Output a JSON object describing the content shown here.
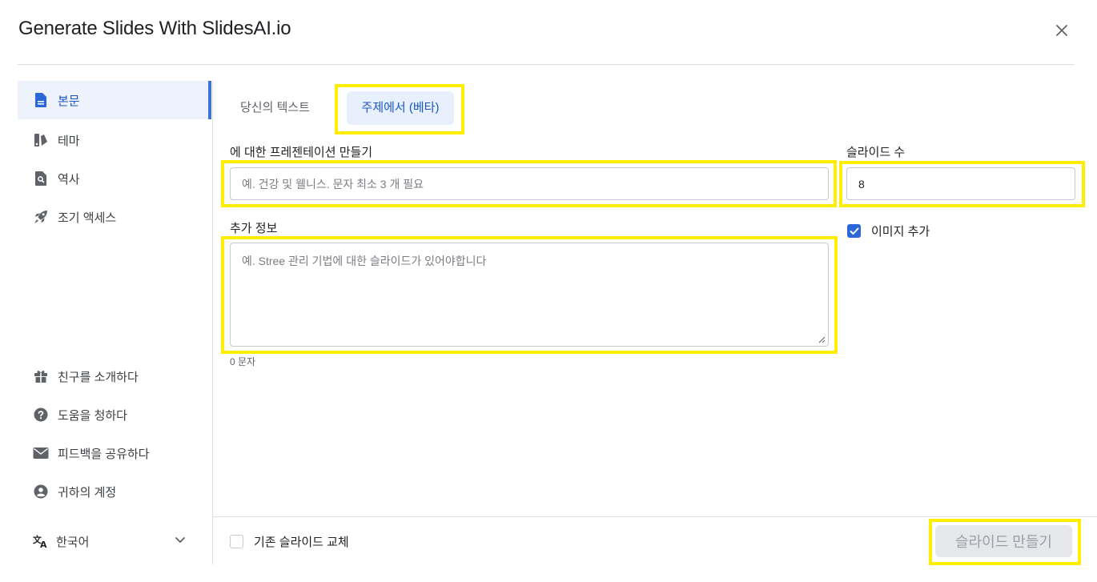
{
  "header": {
    "title": "Generate Slides With SlidesAI.io"
  },
  "sidebar": {
    "items": [
      {
        "label": "본문",
        "icon": "document-icon"
      },
      {
        "label": "테마",
        "icon": "palette-icon"
      },
      {
        "label": "역사",
        "icon": "history-search-icon"
      },
      {
        "label": "조기 액세스",
        "icon": "rocket-icon"
      }
    ],
    "bottom_items": [
      {
        "label": "친구를 소개하다",
        "icon": "gift-icon"
      },
      {
        "label": "도움을 청하다",
        "icon": "help-icon"
      },
      {
        "label": "피드백을 공유하다",
        "icon": "mail-icon"
      },
      {
        "label": "귀하의 계정",
        "icon": "account-icon"
      }
    ],
    "language": "한국어"
  },
  "tabs": {
    "text_tab": "당신의 텍스트",
    "topic_tab": "주제에서 (베타)"
  },
  "form": {
    "topic_label": "에 대한 프레젠테이션 만들기",
    "topic_placeholder": "예. 건강 및 웰니스. 문자 최소 3 개 필요",
    "slides_label": "슬라이드 수",
    "slides_value": "8",
    "info_label": "추가 정보",
    "info_placeholder": "예. Stree 관리 기법에 대한 슬라이드가 있어야합니다",
    "char_count": "0 문자",
    "add_images_label": "이미지 추가",
    "add_images_checked": true
  },
  "footer": {
    "replace_label": "기존 슬라이드 교체",
    "replace_checked": false,
    "create_button": "슬라이드 만들기"
  },
  "colors": {
    "accent": "#2b67d8",
    "highlight": "#ffee00"
  }
}
